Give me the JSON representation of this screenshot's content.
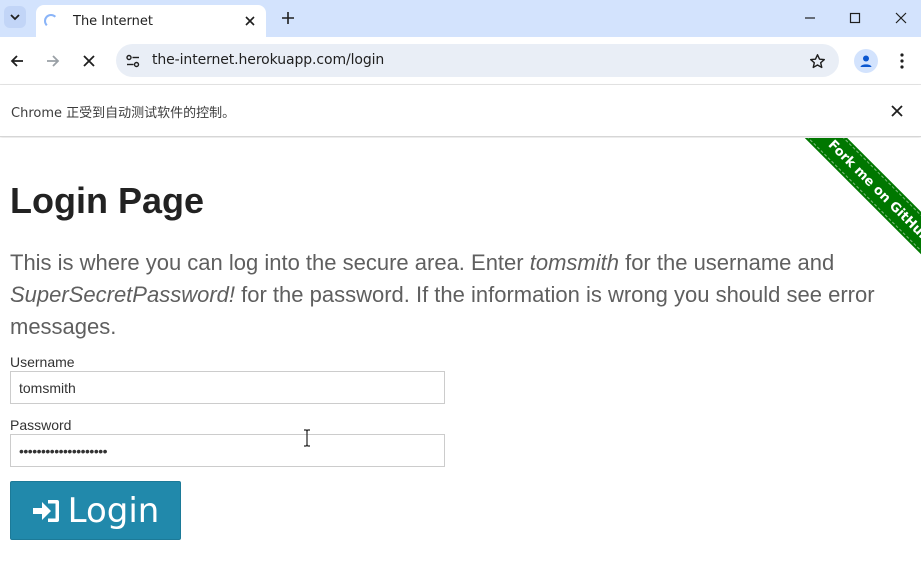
{
  "browser": {
    "tab_title": "The Internet",
    "url": "the-internet.herokuapp.com/login",
    "infobar_text": "Chrome 正受到自动测试软件的控制。"
  },
  "page": {
    "ribbon": "Fork me on GitHub",
    "title": "Login Page",
    "intro_1": "This is where you can log into the secure area. Enter ",
    "intro_user": "tomsmith",
    "intro_2": " for the username and ",
    "intro_pass": "SuperSecretPassword!",
    "intro_3": " for the password. If the information is wrong you should see error messages.",
    "username_label": "Username",
    "username_value": "tomsmith",
    "password_label": "Password",
    "password_value": "••••••••••••••••••••",
    "login_label": "Login"
  },
  "colors": {
    "tabstrip": "#d3e3fd",
    "ribbon": "#007700",
    "login_button": "#2189ab"
  },
  "icons": [
    "tab-search-icon",
    "loading-spinner-icon",
    "close-icon",
    "plus-icon",
    "minimize-icon",
    "maximize-icon",
    "back-arrow-icon",
    "forward-arrow-icon",
    "stop-icon",
    "site-info-icon",
    "star-icon",
    "profile-icon",
    "more-vert-icon",
    "sign-in-icon",
    "text-cursor-icon"
  ]
}
